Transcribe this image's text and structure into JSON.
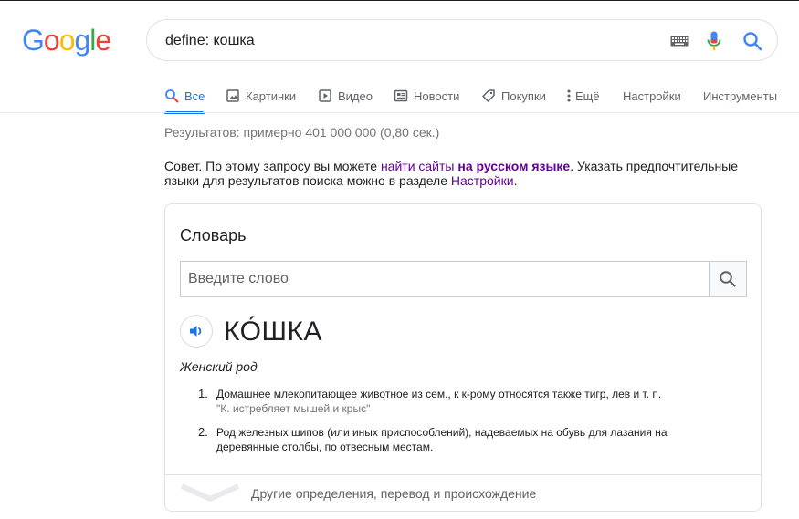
{
  "logo": {
    "letters": [
      "G",
      "o",
      "o",
      "g",
      "l",
      "e"
    ],
    "colors": [
      "#4285F4",
      "#EA4335",
      "#FBBC05",
      "#4285F4",
      "#34A853",
      "#EA4335"
    ]
  },
  "search": {
    "query": "define: кошка"
  },
  "tabs": [
    {
      "label": "Все",
      "icon": "search-icon",
      "active": true
    },
    {
      "label": "Картинки",
      "icon": "image-icon"
    },
    {
      "label": "Видео",
      "icon": "play-icon"
    },
    {
      "label": "Новости",
      "icon": "newspaper-icon"
    },
    {
      "label": "Покупки",
      "icon": "tag-icon"
    },
    {
      "label": "Ещё",
      "icon": "more-vert-icon"
    },
    {
      "label": "Настройки"
    },
    {
      "label": "Инструменты"
    }
  ],
  "stats": "Результатов: примерно 401 000 000 (0,80 сек.)",
  "tip": {
    "prefix": "Совет. По этому запросу вы можете ",
    "link1": "найти сайты",
    "link2": "на русском языке",
    "middle": ". Указать предпочтительные языки для результатов поиска можно в разделе ",
    "link3": "Настройки",
    "suffix": "."
  },
  "dictionary": {
    "title": "Словарь",
    "input_placeholder": "Введите слово",
    "headword": "КО́ШКА",
    "part_of_speech": "Женский род",
    "definitions": [
      {
        "num": "1.",
        "text": "Домашнее млекопитающее животное из сем., к к-рому относятся также тигр, лев и т. п.",
        "example": "\"К. истребляет мышей и крыс\""
      },
      {
        "num": "2.",
        "text": "Род железных шипов (или иных приспособлений), надеваемых на обувь для лазания на деревянные столбы, по отвесным местам.",
        "example": ""
      }
    ],
    "more_label": "Другие определения, перевод и происхождение"
  },
  "colors": {
    "accent": "#1a73e8",
    "visited_link": "#660099",
    "muted": "#70757a"
  }
}
